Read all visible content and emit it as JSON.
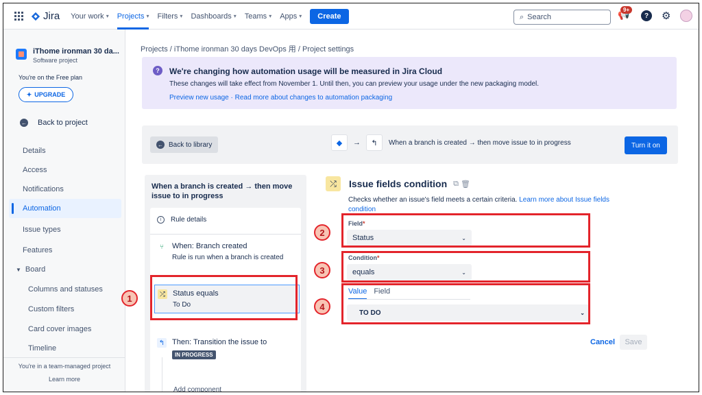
{
  "nav": {
    "logo": "Jira",
    "items": [
      {
        "label": "Your work"
      },
      {
        "label": "Projects"
      },
      {
        "label": "Filters"
      },
      {
        "label": "Dashboards"
      },
      {
        "label": "Teams"
      },
      {
        "label": "Apps"
      }
    ],
    "create": "Create",
    "search": "Search",
    "notifications": "9+",
    "help": "?"
  },
  "sidebar": {
    "project_name": "iThome ironman 30 da...",
    "project_type": "Software project",
    "plan": "You're on the Free plan",
    "upgrade": "UPGRADE",
    "back": "Back to project",
    "items": [
      "Details",
      "Access",
      "Notifications",
      "Automation",
      "Issue types",
      "Features"
    ],
    "board": "Board",
    "board_items": [
      "Columns and statuses",
      "Custom filters",
      "Card cover images",
      "Timeline"
    ],
    "footer": "You're in a team-managed project",
    "learn_more": "Learn more"
  },
  "breadcrumb": "Projects  /  iThome ironman 30 days DevOps 用  /  Project settings",
  "banner": {
    "title": "We're changing how automation usage will be measured in Jira Cloud",
    "body": "These changes will take effect from November 1. Until then, you can preview your usage under the new packaging model.",
    "link1": "Preview new usage",
    "sep": " · ",
    "link2": "Read more about changes to automation packaging"
  },
  "rulebar": {
    "back_library": "Back to library",
    "flow_text": "When a branch is created → then move issue to in progress",
    "turn_on": "Turn it on"
  },
  "rule": {
    "title": "When a branch is created → then move issue to in progress",
    "details": "Rule details",
    "when_title": "When: Branch created",
    "when_sub": "Rule is run when a branch is created",
    "cond_title": "Status equals",
    "cond_sub": "To Do",
    "then_title": "Then: Transition the issue to",
    "then_lozenge": "IN PROGRESS",
    "add": "Add component"
  },
  "condition": {
    "title": "Issue fields condition",
    "desc": "Checks whether an issue's field meets a certain criteria.",
    "desc_link": "Learn more about Issue fields condition",
    "field_label": "Field",
    "field_value": "Status",
    "condition_label": "Condition",
    "condition_value": "equals",
    "tab_value": "Value",
    "tab_field": "Field",
    "value_selected": "TO DO",
    "cancel": "Cancel",
    "save": "Save"
  },
  "annotations": [
    "1",
    "2",
    "3",
    "4"
  ],
  "colors": {
    "accent": "#0c66e4",
    "highlight": "#e3242b",
    "banner": "#ece8fb"
  }
}
